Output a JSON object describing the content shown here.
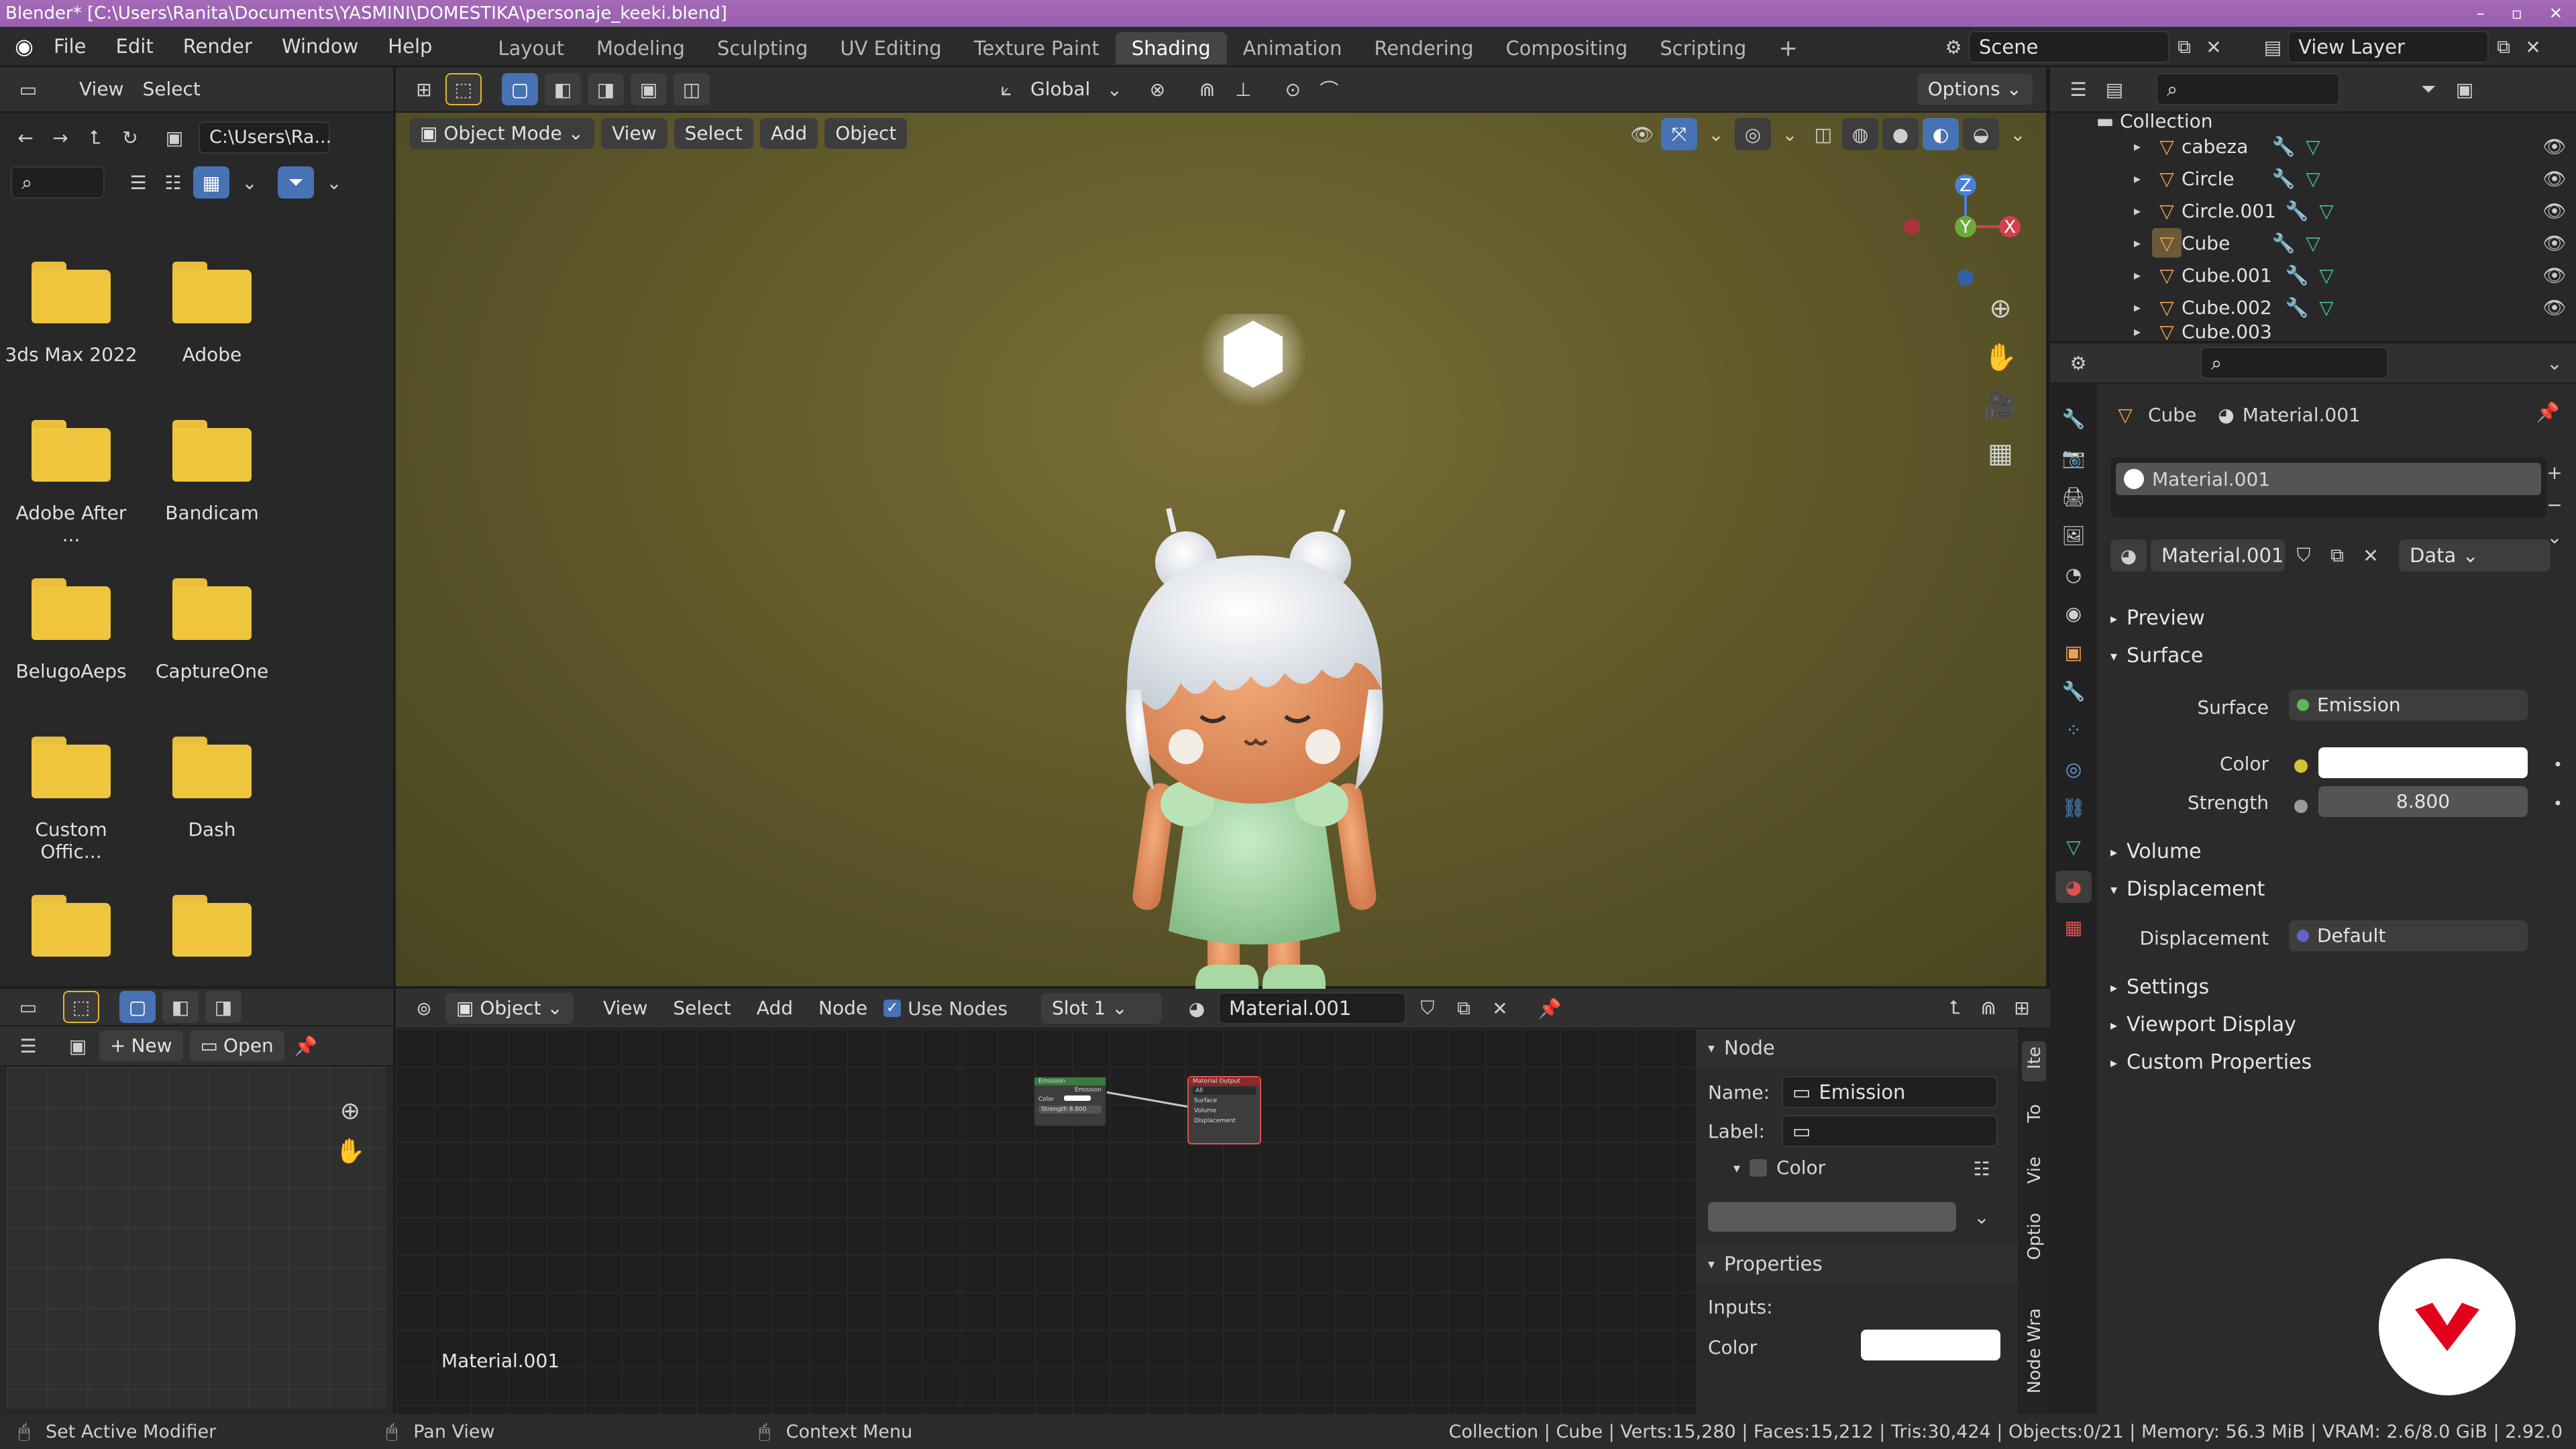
{
  "window": {
    "title": "Blender* [C:\\Users\\Ranita\\Documents\\YASMINI\\DOMESTIKA\\personaje_keeki.blend]"
  },
  "menubar": {
    "items": [
      "File",
      "Edit",
      "Render",
      "Window",
      "Help"
    ],
    "workspaces": [
      "Layout",
      "Modeling",
      "Sculpting",
      "UV Editing",
      "Texture Paint",
      "Shading",
      "Animation",
      "Rendering",
      "Compositing",
      "Scripting"
    ],
    "active_workspace": "Shading",
    "scene": "Scene",
    "view_layer": "View Layer"
  },
  "file_browser": {
    "menu": [
      "View",
      "Select"
    ],
    "path": "C:\\Users\\Ra...",
    "folders": [
      "3ds Max 2022",
      "Adobe",
      "Adobe After ...",
      "Bandicam",
      "BelugoAeps",
      "CaptureOne",
      "Custom Offic...",
      "Dash",
      "",
      ""
    ]
  },
  "viewport": {
    "orientation": "Global",
    "options": "Options",
    "mode": "Object Mode",
    "menu": [
      "View",
      "Select",
      "Add",
      "Object"
    ],
    "gizmo": {
      "z": "Z",
      "y": "Y",
      "x": "X"
    }
  },
  "outliner": {
    "collection": "Collection",
    "objects": [
      "cabeza",
      "Circle",
      "Circle.001",
      "Cube",
      "Cube.001",
      "Cube.002",
      "Cube.003"
    ]
  },
  "properties": {
    "breadcrumb_object": "Cube",
    "breadcrumb_material": "Material.001",
    "slot_name": "Material.001",
    "material_name": "Material.001",
    "link": "Data",
    "sections": {
      "preview": "Preview",
      "surface": "Surface",
      "volume": "Volume",
      "displacement": "Displacement",
      "settings": "Settings",
      "viewport_display": "Viewport Display",
      "custom_properties": "Custom Properties"
    },
    "surface_label": "Surface",
    "surface_value": "Emission",
    "color_label": "Color",
    "color_value": "#ffffff",
    "strength_label": "Strength",
    "strength_value": "8.800",
    "displacement_label": "Displacement",
    "displacement_value": "Default"
  },
  "node_editor": {
    "type": "Object",
    "menu": [
      "View",
      "Select",
      "Add",
      "Node"
    ],
    "use_nodes": "Use Nodes",
    "slot": "Slot 1",
    "material": "Material.001",
    "material_label": "Material.001",
    "emission_node": {
      "title": "Emission",
      "out": "Emission",
      "color": "Color",
      "strength": "Strength  8.800"
    },
    "output_node": {
      "title": "Material Output",
      "target": "All",
      "surface": "Surface",
      "volume": "Volume",
      "displacement": "Displacement"
    },
    "sidebar": {
      "node_header": "Node",
      "name_label": "Name:",
      "name_value": "Emission",
      "label_label": "Label:",
      "color_sub": "Color",
      "properties_header": "Properties",
      "inputs_label": "Inputs:",
      "color_label": "Color",
      "tabs": [
        "Ite",
        "To",
        "Vie",
        "Optio",
        "Node Wra"
      ]
    }
  },
  "image_editor": {
    "new": "New",
    "open": "Open"
  },
  "statusbar": {
    "left1": "Set Active Modifier",
    "left2": "Pan View",
    "left3": "Context Menu",
    "stats": "Collection | Cube | Verts:15,280 | Faces:15,212 | Tris:30,424 | Objects:0/21 | Memory: 56.3 MiB | VRAM: 2.6/8.0 GiB | 2.92.0"
  },
  "colors": {
    "accent": "#4772b3",
    "titlebar": "#9b59b6",
    "viewport_bg": "#615a2b",
    "watermark": "#e2001a"
  }
}
